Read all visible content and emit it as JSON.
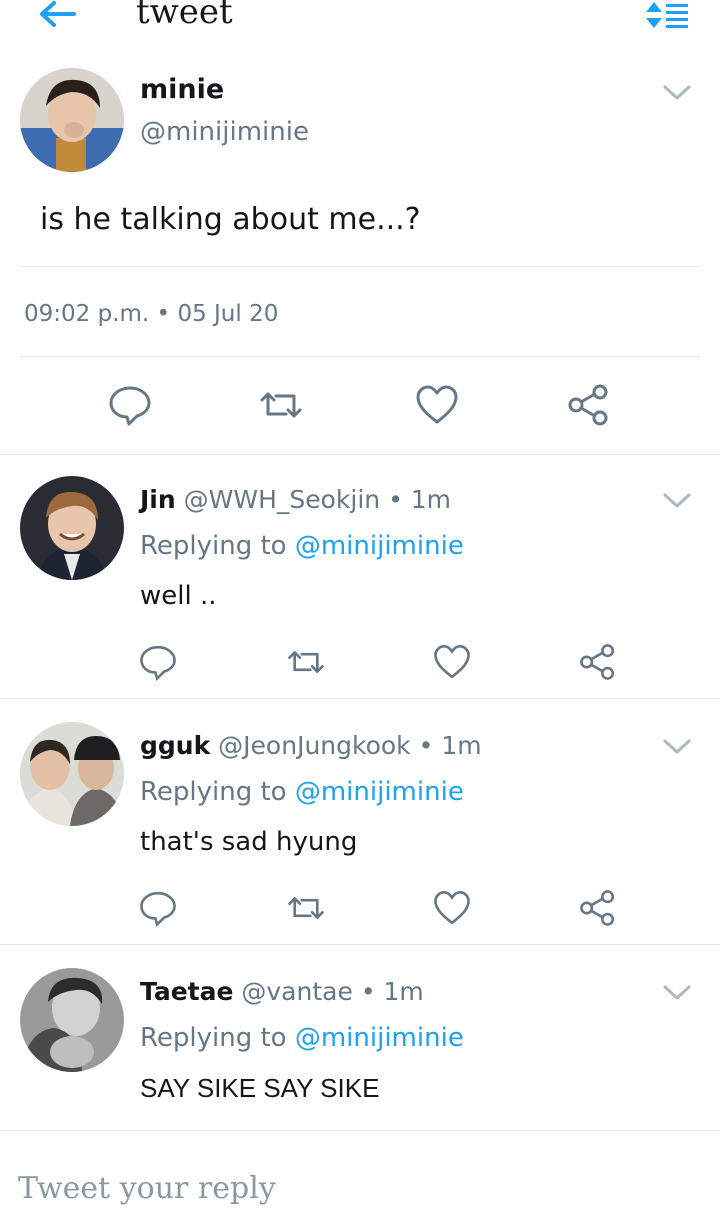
{
  "header": {
    "title": "tweet",
    "back_icon": "arrow-left-icon",
    "sort_icon": "sort-lines-icon",
    "accent": "#1da1f2"
  },
  "tweet": {
    "display_name": "minie",
    "handle": "@minijiminie",
    "text": "is he talking about me...?",
    "time": "09:02 p.m.",
    "date": "05 Jul 20"
  },
  "actions": {
    "reply_icon": "reply-bubble-icon",
    "retweet_icon": "retweet-icon",
    "like_icon": "heart-icon",
    "share_icon": "share-icon"
  },
  "replies": [
    {
      "name": "Jin",
      "handle": "@WWH_Seokjin",
      "time": "1m",
      "replying_prefix": "Replying to",
      "mention": "@minijiminie",
      "text": "well .."
    },
    {
      "name": "gguk",
      "handle": "@JeonJungkook",
      "time": "1m",
      "replying_prefix": "Replying to",
      "mention": "@minijiminie",
      "text": "that's sad hyung"
    },
    {
      "name": "Taetae",
      "handle": "@vantae",
      "time": "1m",
      "replying_prefix": "Replying to",
      "mention": "@minijiminie",
      "text": "SAY SIKE SAY SIKE"
    }
  ],
  "compose": {
    "placeholder": "Tweet your reply"
  },
  "separator_dot": "•"
}
